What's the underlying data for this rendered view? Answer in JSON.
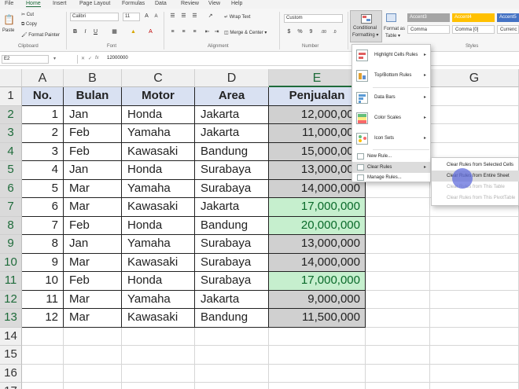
{
  "ribbon_tabs": [
    "File",
    "Home",
    "Insert",
    "Page Layout",
    "Formulas",
    "Data",
    "Review",
    "View",
    "Help"
  ],
  "ribbon": {
    "paste_label": "Paste",
    "cut_label": "Cut",
    "copy_label": "Copy",
    "format_painter_label": "Format Painter",
    "clipboard_group": "Clipboard",
    "font_name": "Calibri",
    "font_size": "11",
    "font_group": "Font",
    "wrap_text_label": "Wrap Text",
    "merge_center_label": "Merge & Center",
    "alignment_group": "Alignment",
    "number_format": "Custom",
    "number_group": "Number",
    "conditional_formatting_label_1": "Conditional",
    "conditional_formatting_label_2": "Formatting",
    "format_as_table_label_1": "Format as",
    "format_as_table_label_2": "Table",
    "styles_group": "Styles",
    "style_cells": [
      "Accent3",
      "Accent4",
      "Accent5",
      "Comma",
      "Comma [0]",
      "Currenc"
    ]
  },
  "formula_bar": {
    "name_box": "E2",
    "value": "12000000"
  },
  "columns": [
    "A",
    "B",
    "C",
    "D",
    "E",
    "F",
    "G"
  ],
  "row_numbers": [
    "1",
    "2",
    "3",
    "4",
    "5",
    "6",
    "7",
    "8",
    "9",
    "10",
    "11",
    "12",
    "13",
    "14",
    "15",
    "16",
    "17"
  ],
  "table": {
    "headers": [
      "No.",
      "Bulan",
      "Motor",
      "Area",
      "Penjualan"
    ],
    "rows": [
      [
        "1",
        "Jan",
        "Honda",
        "Jakarta",
        "12,000,000"
      ],
      [
        "2",
        "Feb",
        "Yamaha",
        "Jakarta",
        "11,000,000"
      ],
      [
        "3",
        "Feb",
        "Kawasaki",
        "Bandung",
        "15,000,000"
      ],
      [
        "4",
        "Jan",
        "Honda",
        "Surabaya",
        "13,000,000"
      ],
      [
        "5",
        "Mar",
        "Yamaha",
        "Surabaya",
        "14,000,000"
      ],
      [
        "6",
        "Mar",
        "Kawasaki",
        "Jakarta",
        "17,000,000"
      ],
      [
        "7",
        "Feb",
        "Honda",
        "Bandung",
        "20,000,000"
      ],
      [
        "8",
        "Jan",
        "Yamaha",
        "Surabaya",
        "13,000,000"
      ],
      [
        "9",
        "Mar",
        "Kawasaki",
        "Surabaya",
        "14,000,000"
      ],
      [
        "10",
        "Feb",
        "Honda",
        "Surabaya",
        "17,000,000"
      ],
      [
        "11",
        "Mar",
        "Yamaha",
        "Jakarta",
        "9,000,000"
      ],
      [
        "12",
        "Mar",
        "Kawasaki",
        "Bandung",
        "11,500,000"
      ]
    ],
    "highlight": [
      "gray",
      "gray",
      "gray",
      "gray",
      "gray",
      "green",
      "green",
      "gray",
      "gray",
      "green",
      "gray",
      "gray"
    ]
  },
  "cf_menu": {
    "highlight_cells_rules": "Highlight Cells Rules",
    "top_bottom_rules": "Top/Bottom Rules",
    "data_bars": "Data Bars",
    "color_scales": "Color Scales",
    "icon_sets": "Icon Sets",
    "new_rule": "New Rule...",
    "clear_rules": "Clear Rules",
    "manage_rules": "Manage Rules..."
  },
  "clear_rules_menu": {
    "from_selected_cells": "Clear Rules from Selected Cells",
    "from_entire_sheet": "Clear Rules from Entire Sheet",
    "from_this_table": "Clear Rules from This Table",
    "from_this_pivot": "Clear Rules from This PivotTable"
  },
  "colors": {
    "accent_green": "#1e6b3a",
    "header_fill": "#d9e1f2",
    "cf_gray": "#d0d0d0",
    "cf_green": "#c6efce"
  }
}
